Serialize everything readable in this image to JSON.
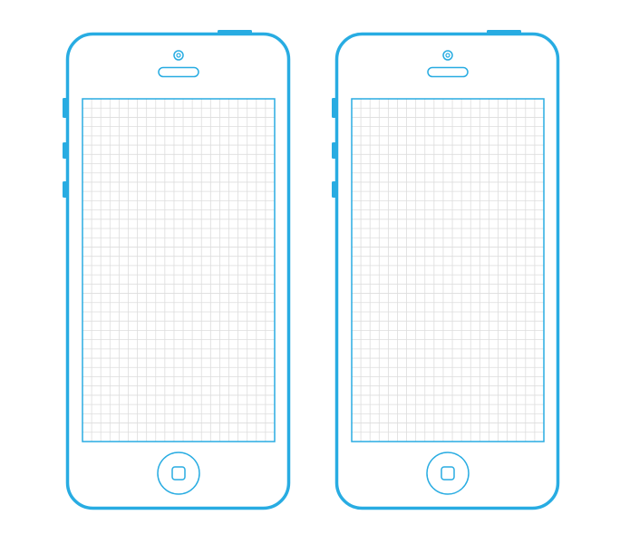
{
  "colors": {
    "outline": "#28ACE2",
    "grid_line": "#DDDDDD",
    "background": "#FFFFFF"
  },
  "phones": [
    {
      "id": "left",
      "screen_grid": {
        "columns": 21,
        "rows": 37
      }
    },
    {
      "id": "right",
      "screen_grid": {
        "columns": 21,
        "rows": 37
      }
    }
  ]
}
